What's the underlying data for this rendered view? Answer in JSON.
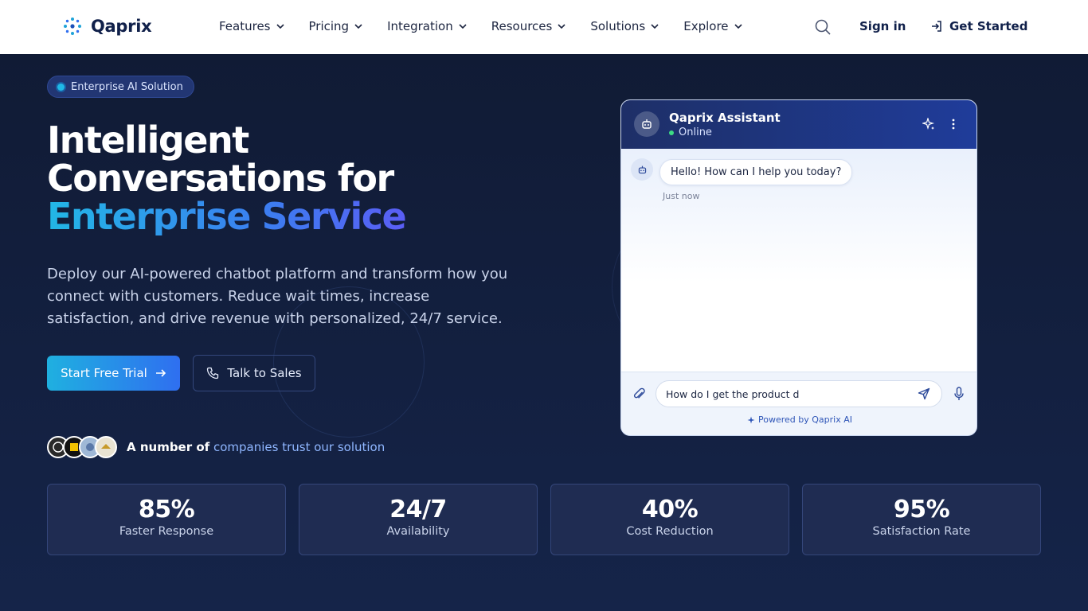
{
  "nav": {
    "brand": "Qaprix",
    "items": [
      {
        "label": "Features"
      },
      {
        "label": "Pricing"
      },
      {
        "label": "Integration"
      },
      {
        "label": "Resources"
      },
      {
        "label": "Solutions"
      },
      {
        "label": "Explore"
      }
    ],
    "sign_in": "Sign in",
    "get_started": "Get Started"
  },
  "hero": {
    "badge": "Enterprise AI Solution",
    "headline_line1": "Intelligent",
    "headline_line2": "Conversations for",
    "headline_highlight": "Enterprise Service",
    "subtext": "Deploy our AI-powered chatbot platform and transform how you connect with customers. Reduce wait times, increase satisfaction, and drive revenue with personalized, 24/7 service.",
    "primary_cta": "Start Free Trial",
    "secondary_cta": "Talk to Sales",
    "trust_prefix": "A number of",
    "trust_highlight": "companies trust our solution"
  },
  "chat": {
    "title": "Qaprix Assistant",
    "status": "Online",
    "messages": [
      {
        "text": "Hello! How can I help you today?",
        "time": "Just now"
      }
    ],
    "input_value": "How do I get the product d",
    "powered_by": "Powered by Qaprix AI"
  },
  "stats": [
    {
      "value": "85%",
      "label": "Faster Response"
    },
    {
      "value": "24/7",
      "label": "Availability"
    },
    {
      "value": "40%",
      "label": "Cost Reduction"
    },
    {
      "value": "95%",
      "label": "Satisfaction Rate"
    }
  ],
  "colors": {
    "accent_cyan": "#1fb0e0",
    "accent_blue": "#2f6ff0",
    "navy": "#101a33",
    "online": "#3ddc84"
  },
  "icons": {
    "brand": "dot-cluster-icon",
    "search": "search-icon",
    "get_started": "sign-in-arrow-icon",
    "cta_arrow": "arrow-right-icon",
    "phone": "phone-icon",
    "bot": "robot-icon",
    "sparkle": "sparkle-icon",
    "more": "more-vertical-icon",
    "attach": "paperclip-icon",
    "send": "send-icon",
    "mic": "microphone-icon"
  }
}
